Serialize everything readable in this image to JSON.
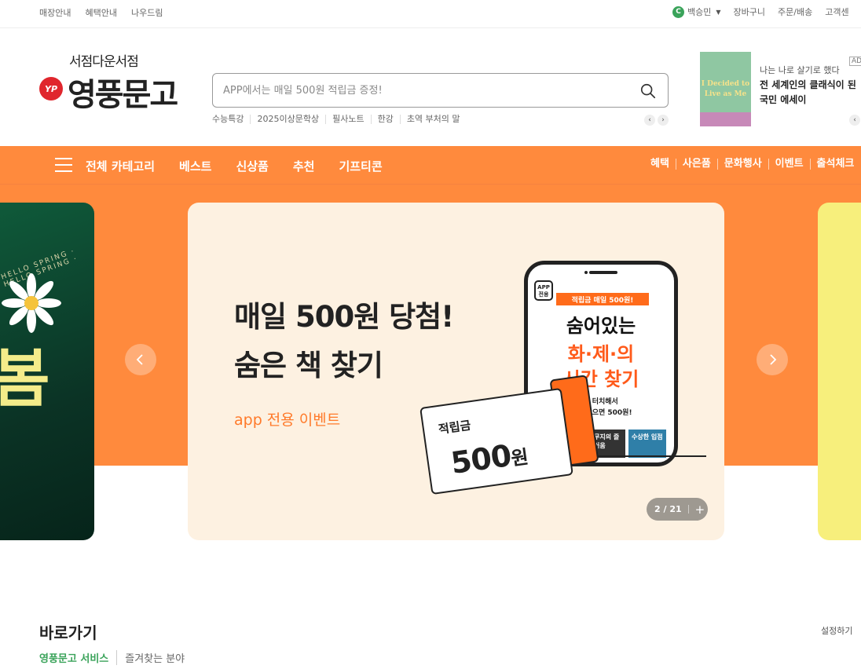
{
  "top_links_left": [
    "매장안내",
    "혜택안내",
    "나우드림"
  ],
  "user": {
    "badge": "C",
    "name": "백승민"
  },
  "top_links_right": [
    "장바구니",
    "주문/배송",
    "고객센"
  ],
  "logo": {
    "tagline": "서점다운서점",
    "name": "영풍문고",
    "mark": "YP"
  },
  "search": {
    "placeholder": "APP에서는 매일 500원 적립금 증정!",
    "keywords": [
      "수능특강",
      "2025이상문학상",
      "필사노트",
      "한강",
      "초역 부처의 말"
    ]
  },
  "ad": {
    "label": "AD",
    "book_cover_text": "I Decided to Live as Me",
    "subtitle": "나는 나로 살기로 했다",
    "title_line1": "전 세계인의 클래식이 된",
    "title_line2": "국민 에세이"
  },
  "nav": {
    "main": [
      "전체 카테고리",
      "베스트",
      "신상품",
      "추천",
      "기프티콘"
    ],
    "right": [
      "혜택",
      "사은품",
      "문화행사",
      "이벤트",
      "출석체크"
    ]
  },
  "banner": {
    "title_line1": "매일 500원 당첨!",
    "title_line2": "숨은 책 찾기",
    "subtitle": "app 전용 이벤트",
    "phone": {
      "app_tag": "APP 전용",
      "strip": "적립금 매일 500원!",
      "line1": "숨어있는",
      "line2": "화·제·의",
      "line3": "시간 찾기",
      "desc1": "지를 터치해서",
      "desc2": "간 찾으면 500원!",
      "mini1": "무지의 즐거움",
      "mini2": "수상한 입점"
    },
    "ticket_label": "적립금",
    "ticket_value": "500",
    "ticket_unit": "원",
    "counter": "2 / 21",
    "counter_plus": "+"
  },
  "side_left": {
    "spring_text": "HELLO SPRING · HELLO SPRING ·",
    "big_text": "봄"
  },
  "quick": {
    "title": "바로가기",
    "settings": "설정하기",
    "tabs": [
      "영풍문고 서비스",
      "즐겨찾는 분야"
    ]
  },
  "colors": {
    "accent": "#ff8a3d",
    "green": "#3aa35a",
    "logo_red": "#e0262d"
  }
}
